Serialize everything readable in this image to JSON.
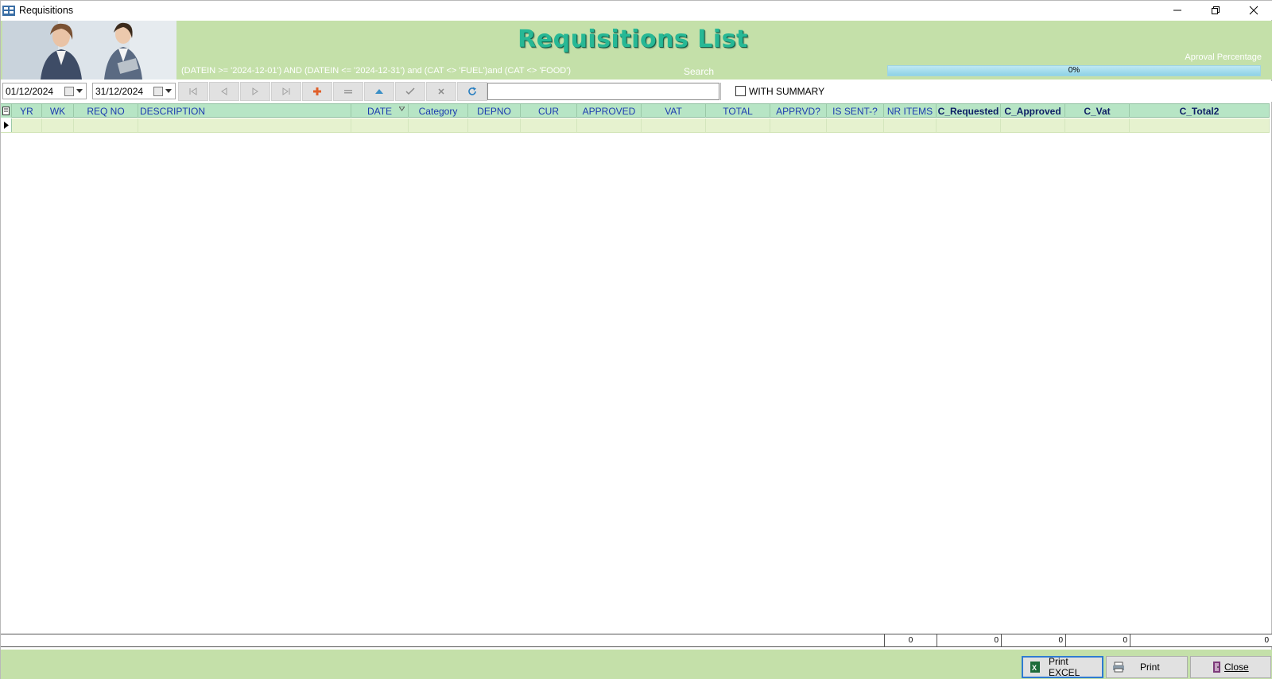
{
  "window": {
    "title": "Requisitions",
    "app_icon": "app-grid-icon",
    "controls": [
      "minimize-icon",
      "restore-icon",
      "close-icon"
    ]
  },
  "header": {
    "title": "Requisitions List",
    "filter_text": "(DATEIN >= '2024-12-01') AND  (DATEIN  <= '2024-12-31') and (CAT  <> 'FUEL')and (CAT <> 'FOOD')",
    "search_label": "Search",
    "approval_label": "Aproval Percentage",
    "progress_text": "0%",
    "progress_value": 0
  },
  "toolbar": {
    "date_from": "01/12/2024",
    "date_to": "31/12/2024",
    "nav_buttons": [
      "first-icon",
      "prior-icon",
      "next-icon",
      "last-icon",
      "insert-icon",
      "delete-icon",
      "edit-icon",
      "post-icon",
      "cancel-icon",
      "refresh-icon"
    ],
    "search_value": "",
    "with_summary_label": "WITH SUMMARY",
    "with_summary_checked": false
  },
  "grid": {
    "columns": [
      "YR",
      "WK",
      "REQ NO",
      "DESCRIPTION",
      "DATE",
      "Category",
      "DEPNO",
      "CUR",
      "APPROVED",
      "VAT",
      "TOTAL",
      "APPRVD?",
      "IS SENT-?",
      "NR ITEMS",
      "C_Requested",
      "C_Approved",
      "C_Vat",
      "C_Total2"
    ],
    "rows": []
  },
  "totals": {
    "nr_items": "0",
    "c_requested": "0",
    "c_approved": "0",
    "c_vat": "0",
    "c_total2": "0"
  },
  "buttons": {
    "print_excel": "Print EXCEL",
    "print": "Print",
    "close": "Close"
  },
  "colors": {
    "header_bg": "#c4e0a9",
    "title": "#27b895",
    "grid_header": "#b7e5c5",
    "grid_row": "#e6f2cf",
    "progress": "#8ed2e6"
  }
}
